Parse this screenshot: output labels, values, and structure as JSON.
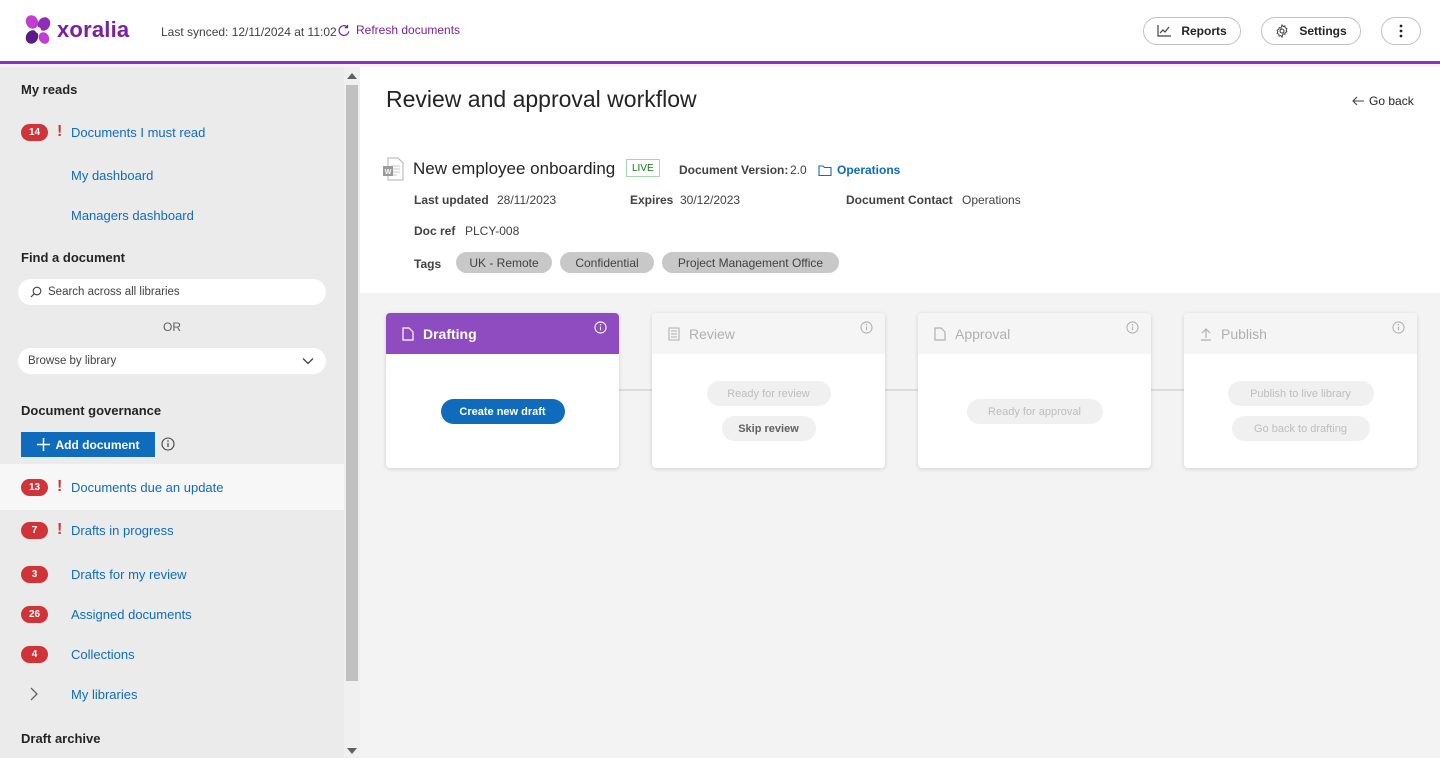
{
  "app": {
    "name": "xoralia",
    "brand_color": "#7a1fa2",
    "accent": "#0f6cbd",
    "alert_color": "#d13438"
  },
  "topbar": {
    "last_synced": "Last synced: 12/11/2024 at 11:02",
    "refresh": "Refresh documents",
    "reports": "Reports",
    "settings": "Settings"
  },
  "sidebar": {
    "my_reads": "My reads",
    "must_read": {
      "count": "14",
      "label": "Documents I must read"
    },
    "my_dashboard": "My dashboard",
    "managers_dashboard": "Managers dashboard",
    "find_document": "Find a document",
    "search_placeholder": "Search across all libraries",
    "or": "OR",
    "browse": "Browse by library",
    "governance": "Document governance",
    "add_document": "Add document",
    "due_update": {
      "count": "13",
      "label": "Documents due an update"
    },
    "drafts_progress": {
      "count": "7",
      "label": "Drafts in progress"
    },
    "drafts_review": {
      "count": "3",
      "label": "Drafts for my review"
    },
    "assigned": {
      "count": "26",
      "label": "Assigned documents"
    },
    "collections": {
      "count": "4",
      "label": "Collections"
    },
    "my_libraries": "My libraries",
    "draft_archive": "Draft archive"
  },
  "main": {
    "title": "Review and approval workflow",
    "go_back": "Go back",
    "document": {
      "name": "New employee onboarding",
      "status": "LIVE",
      "version_label": "Document Version:",
      "version": "2.0",
      "library": "Operations",
      "last_updated_label": "Last updated",
      "last_updated": "28/11/2023",
      "expires_label": "Expires",
      "expires": "30/12/2023",
      "contact_label": "Document Contact",
      "contact": "Operations",
      "docref_label": "Doc ref",
      "docref": "PLCY-008",
      "tags_label": "Tags",
      "tags": [
        "UK - Remote",
        "Confidential",
        "Project Management Office"
      ]
    },
    "stages": [
      {
        "name": "Drafting",
        "buttons": [
          "Create new draft"
        ]
      },
      {
        "name": "Review",
        "buttons": [
          "Ready for review",
          "Skip review"
        ]
      },
      {
        "name": "Approval",
        "buttons": [
          "Ready for approval"
        ]
      },
      {
        "name": "Publish",
        "buttons": [
          "Publish to live library",
          "Go back to drafting"
        ]
      }
    ]
  }
}
